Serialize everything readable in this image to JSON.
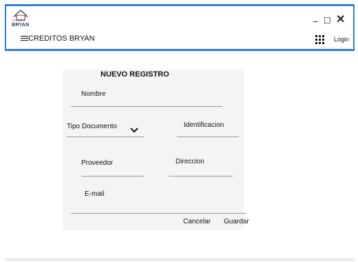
{
  "titlebar": {
    "logo_small": "creditos",
    "logo_big": "BRYAN",
    "minimize_glyph": "−",
    "maximize_glyph": "☐",
    "close_glyph": "✕"
  },
  "header": {
    "app_title": "CREDITOS BRYAN",
    "login_label": "Login",
    "menu_icon": "hamburger-icon",
    "apps_icon": "grid-icon"
  },
  "form": {
    "title": "NUEVO REGISTRO",
    "nombre_label": "Nombre",
    "tipo_documento_value": "Tipo Documento",
    "identificacion_label": "Identificacion",
    "proveedor_label": "Proveedor",
    "direccion_label": "Direccion",
    "email_label": "E-mail",
    "cancel_label": "Cancelar",
    "save_label": "Guardar"
  },
  "colors": {
    "accent_blue": "#2f80d8",
    "card_bg": "#f4f4f4",
    "logo_red": "#c0392b",
    "logo_navy": "#1e3d6b"
  }
}
